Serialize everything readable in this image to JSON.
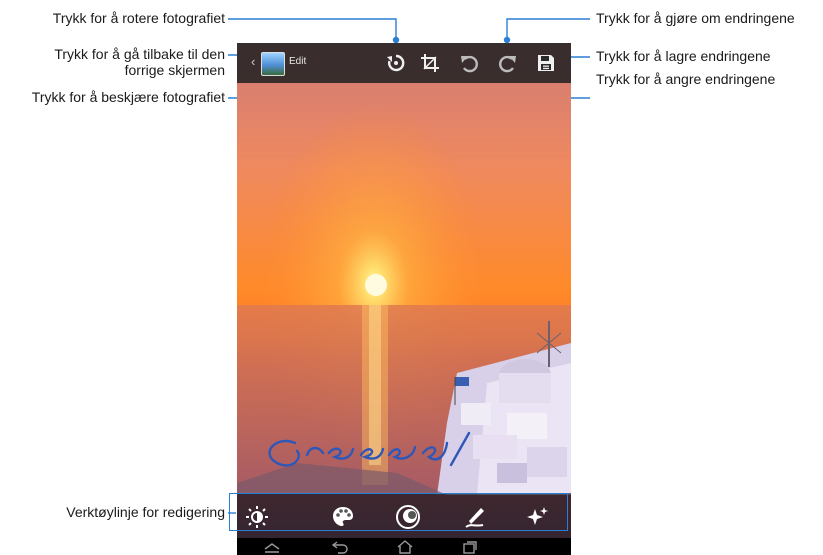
{
  "callouts": {
    "rotate": "Trykk for å rotere fotografiet",
    "back_line1": "Trykk for å gå tilbake til den",
    "back_line2": "forrige skjermen",
    "crop": "Trykk for å beskjære fotografiet",
    "redo": "Trykk for å gjøre om endringene",
    "save": "Trykk for å lagre endringene",
    "undo": "Trykk for å angre endringene",
    "toolbar": "Verktøylinje for redigering"
  },
  "app": {
    "title": "Edit"
  },
  "icons": {
    "back": "chevron-left-icon",
    "rotate": "rotate-icon",
    "crop": "crop-icon",
    "undo": "undo-icon",
    "redo": "redo-icon",
    "save": "save-icon",
    "brightness": "brightness-icon",
    "color": "palette-icon",
    "effects": "effects-icon",
    "draw": "draw-pen-icon",
    "enhance": "sparkle-icon",
    "nav_back": "nav-back-icon",
    "nav_home": "nav-home-icon",
    "nav_recent": "nav-recent-apps-icon",
    "nav_up": "nav-up-icon"
  },
  "colors": {
    "callout_line": "#2a7fd4",
    "actionbar": "#2a2a2a",
    "sky_top": "#f0a26a",
    "sun": "#fff3a0"
  }
}
